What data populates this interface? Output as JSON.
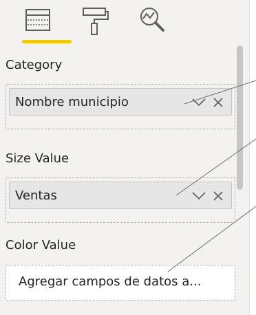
{
  "tabs": [
    {
      "icon": "fields-icon",
      "active": true
    },
    {
      "icon": "format-paint-roller-icon",
      "active": false
    },
    {
      "icon": "analytics-magnifier-icon",
      "active": false
    }
  ],
  "colors": {
    "active_tab_underline": "#f2c811",
    "pane_background": "#f3f2f1",
    "pill_background": "#e6e6e6"
  },
  "wells": {
    "category": {
      "label": "Category",
      "field": "Nombre municipio"
    },
    "size_value": {
      "label": "Size Value",
      "field": "Ventas"
    },
    "color_value": {
      "label": "Color Value",
      "placeholder": "Agregar campos de datos a..."
    }
  }
}
